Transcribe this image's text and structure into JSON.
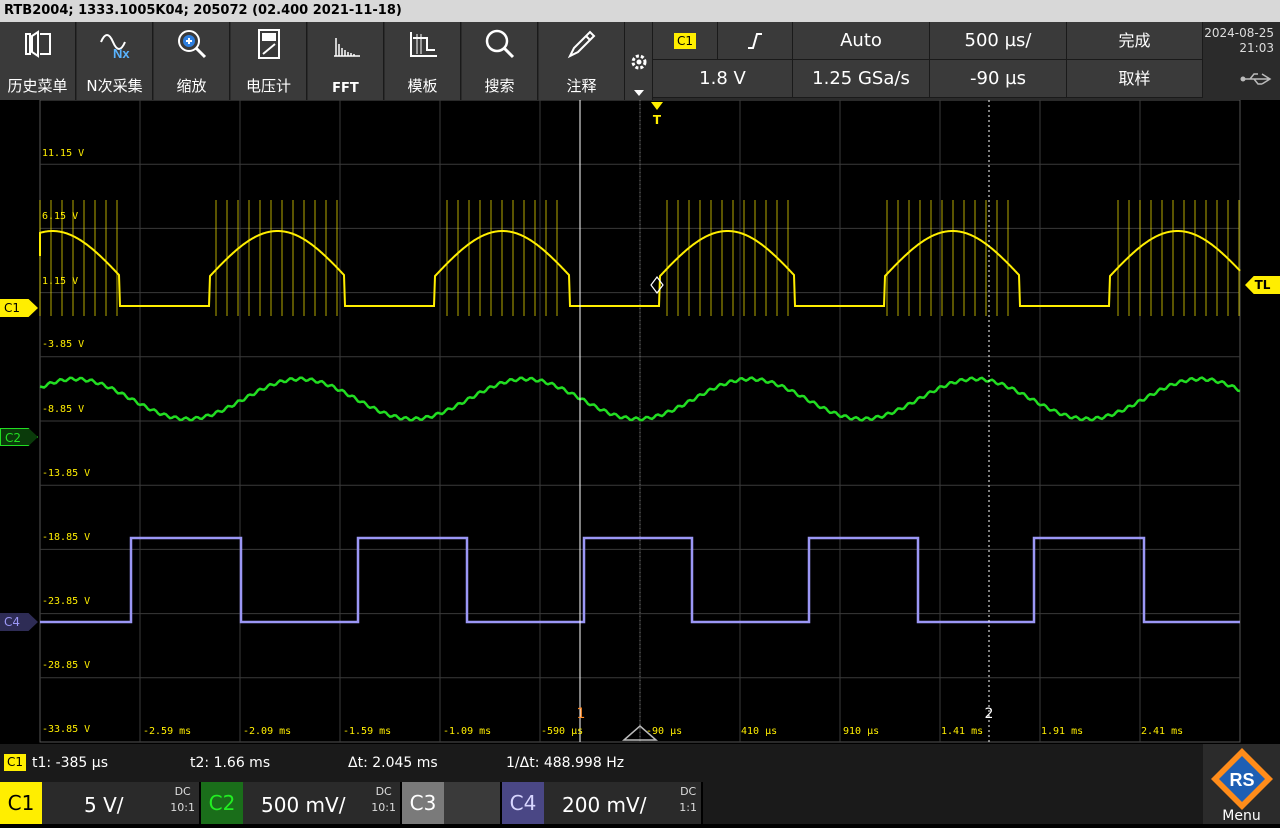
{
  "title_bar": "RTB2004; 1333.1005K04; 205072 (02.400 2021-11-18)",
  "toolbar": [
    {
      "label": "历史菜单",
      "icon": "history-icon"
    },
    {
      "label": "N次采集",
      "icon": "nx-acquisition-icon"
    },
    {
      "label": "缩放",
      "icon": "zoom-icon"
    },
    {
      "label": "电压计",
      "icon": "voltmeter-icon"
    },
    {
      "label": "FFT",
      "icon": "fft-icon"
    },
    {
      "label": "模板",
      "icon": "mask-icon"
    },
    {
      "label": "搜索",
      "icon": "search-icon"
    },
    {
      "label": "注释",
      "icon": "annotation-pen-icon"
    }
  ],
  "trigger": {
    "source": "C1",
    "slope_icon": "rising-edge-icon",
    "mode": "Auto",
    "level": "1.8 V",
    "state": "完成"
  },
  "acquisition": {
    "timebase": "500 µs/",
    "sample_rate": "1.25 GSa/s",
    "position": "-90 µs",
    "mode": "取样"
  },
  "datetime": {
    "date": "2024-08-25",
    "time": "21:03"
  },
  "y_labels": [
    "11.15 V",
    "6.15 V",
    "1.15 V",
    "-3.85 V",
    "-8.85 V",
    "-13.85 V",
    "-18.85 V",
    "-23.85 V",
    "-28.85 V",
    "-33.85 V"
  ],
  "x_labels": [
    "-2.59 ms",
    "-2.09 ms",
    "-1.59 ms",
    "-1.09 ms",
    "-590 µs",
    "-90 µs",
    "410 µs",
    "910 µs",
    "1.41 ms",
    "1.91 ms",
    "2.41 ms"
  ],
  "markers": {
    "trigger_top": "T",
    "trigger_level": "TL",
    "cursor1": "1",
    "cursor2": "2"
  },
  "channel_markers": [
    "C1",
    "C2",
    "C4"
  ],
  "cursors": {
    "badge": "C1",
    "t1": "t1: -385 µs",
    "t2": "t2: 1.66 ms",
    "dt": "Δt: 2.045 ms",
    "inv_dt": "1/Δt: 488.998 Hz"
  },
  "channels": [
    {
      "name": "C1",
      "scale": "5 V/",
      "coupling": "DC",
      "ratio": "10:1",
      "color": "#ffee00"
    },
    {
      "name": "C2",
      "scale": "500 mV/",
      "coupling": "DC",
      "ratio": "10:1",
      "color": "#00c800"
    },
    {
      "name": "C3",
      "scale": "",
      "coupling": "",
      "ratio": "",
      "color": "#888888"
    },
    {
      "name": "C4",
      "scale": "200 mV/",
      "coupling": "DC",
      "ratio": "1:1",
      "color": "#9b97f5"
    }
  ],
  "menu_label": "Menu",
  "colors": {
    "c1": "#ffee00",
    "c2": "#22dd22",
    "c4": "#9b97f5",
    "grid": "#3a3a3a",
    "cursor1": "#ff8c2a"
  }
}
